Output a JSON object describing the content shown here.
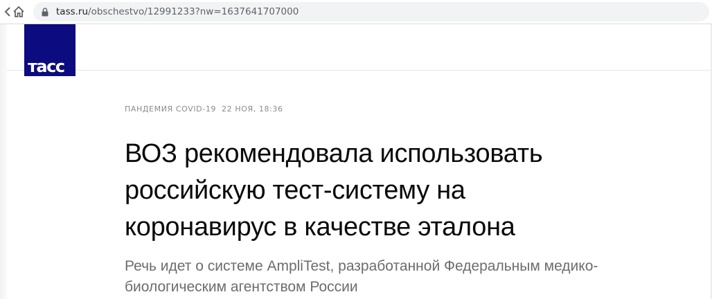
{
  "browser": {
    "back_icon": "chevron-left-icon",
    "home_icon": "home-icon",
    "lock_icon": "lock-icon",
    "url_host": "tass.ru",
    "url_path": "/obschestvo/12991233?nw=1637641707000"
  },
  "site": {
    "logo_text": "тасс",
    "logo_color": "#0c0b7f"
  },
  "article": {
    "rubric": "ПАНДЕМИЯ COVID-19",
    "date": "22 НОЯ, 18:36",
    "headline": "ВОЗ рекомендовала использовать российскую тест-систему на коронавирус в качестве эталона",
    "lead": "Речь идет о системе AmpliTest, разработанной Федеральным медико-биологическим агентством России"
  }
}
